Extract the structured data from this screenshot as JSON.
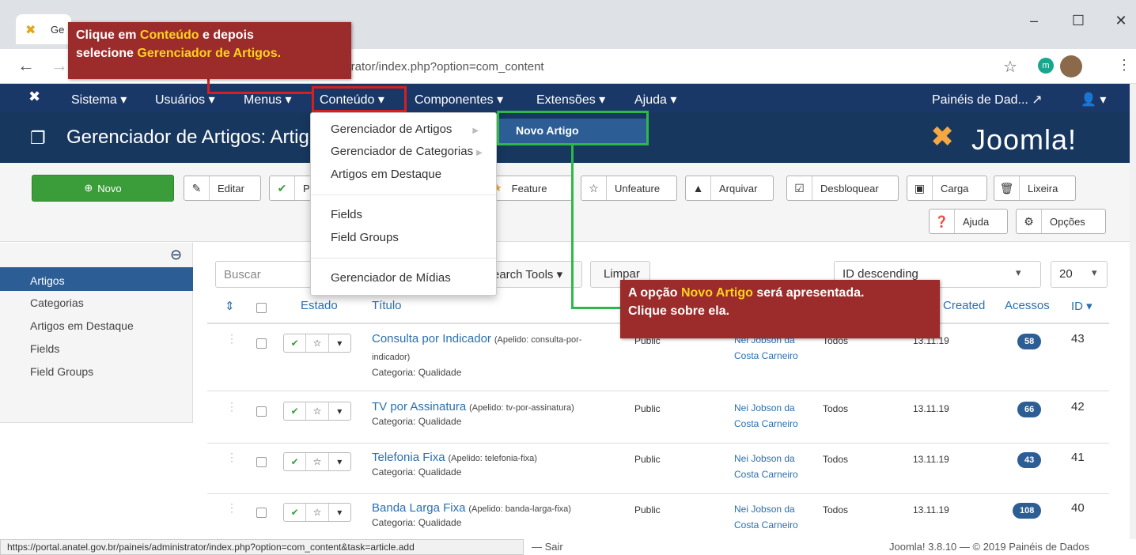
{
  "browser": {
    "tab_title": "Ge",
    "url": "strator/index.php?option=com_content",
    "ext_badge": "m",
    "min": "–",
    "max": "☐",
    "close": "✕"
  },
  "nav": {
    "items": [
      "Sistema ▾",
      "Usuários ▾",
      "Menus ▾",
      "Conteúdo ▾",
      "Componentes ▾",
      "Extensões ▾",
      "Ajuda ▾"
    ],
    "right": "Painéis de Dad... ↗",
    "user": "👤 ▾"
  },
  "header": {
    "title": "Gerenciador de Artigos: Artig",
    "logo": "Joomla!"
  },
  "toolbar": {
    "new": "Novo",
    "edit": "Editar",
    "publish": "P",
    "feature": "Feature",
    "unfeature": "Unfeature",
    "archive": "Arquivar",
    "checkin": "Desbloquear",
    "batch": "Carga",
    "trash": "Lixeira",
    "help": "Ajuda",
    "options": "Opções"
  },
  "sidebar": {
    "items": [
      "Artigos",
      "Categorias",
      "Artigos em Destaque",
      "Fields",
      "Field Groups"
    ]
  },
  "filters": {
    "search_placeholder": "Buscar",
    "search_tools": "earch Tools ▾",
    "clear": "Limpar",
    "ordering": "ID descending",
    "limit": "20"
  },
  "table": {
    "headers": {
      "status": "Estado",
      "title": "Título",
      "created": "Created",
      "hits": "Acessos",
      "id": "ID ▾"
    },
    "rows": [
      {
        "title": "Consulta por Indicador",
        "alias_a": "(Apelido: consulta-por-",
        "alias_b": "indicador)",
        "category": "Categoria: Qualidade",
        "access": "Public",
        "author1": "Nei Jobson da",
        "author2": "Costa Carneiro",
        "language": "Todos",
        "date": "13.11.19",
        "hits": "58",
        "id": "43"
      },
      {
        "title": "TV por Assinatura",
        "alias_a": "(Apelido: tv-por-assinatura)",
        "alias_b": "",
        "category": "Categoria: Qualidade",
        "access": "Public",
        "author1": "Nei Jobson da",
        "author2": "Costa Carneiro",
        "language": "Todos",
        "date": "13.11.19",
        "hits": "66",
        "id": "42"
      },
      {
        "title": "Telefonia Fixa",
        "alias_a": "(Apelido: telefonia-fixa)",
        "alias_b": "",
        "category": "Categoria: Qualidade",
        "access": "Public",
        "author1": "Nei Jobson da",
        "author2": "Costa Carneiro",
        "language": "Todos",
        "date": "13.11.19",
        "hits": "43",
        "id": "41"
      },
      {
        "title": "Banda Larga Fixa",
        "alias_a": "(Apelido: banda-larga-fixa)",
        "alias_b": "",
        "category": "Categoria: Qualidade",
        "access": "Public",
        "author1": "Nei Jobson da",
        "author2": "Costa Carneiro",
        "language": "Todos",
        "date": "13.11.19",
        "hits": "108",
        "id": "40"
      }
    ]
  },
  "content_menu": {
    "items": [
      "Gerenciador de Artigos",
      "Gerenciador de Categorias",
      "Artigos em Destaque",
      "Fields",
      "Field Groups",
      "Gerenciador de Mídias"
    ],
    "submenu_item": "Novo Artigo"
  },
  "annotations": {
    "callout1_a": "Clique em ",
    "callout1_hl1": "Conteúdo",
    "callout1_b": " e depois",
    "callout1_c": "selecione ",
    "callout1_hl2": "Gerenciador de Artigos.",
    "callout2_a": "A opção ",
    "callout2_hl": "Novo Artigo",
    "callout2_b": " será apresentada.",
    "callout2_c": "Clique sobre ela."
  },
  "status": {
    "url": "https://portal.anatel.gov.br/paineis/administrator/index.php?option=com_content&task=article.add",
    "logout": "— Sair",
    "footer": "Joomla! 3.8.10 — © 2019 Painéis de Dados"
  },
  "colors": {
    "nav_bg": "#1a3867",
    "header_bg": "#17375f",
    "accent_green": "#3a9d3a",
    "link_blue": "#2a6fb0",
    "callout_red": "#9b2c2b",
    "highlight_yellow": "#ffd21e",
    "annotation_green": "#2eb84a",
    "annotation_red": "#d61f1f"
  }
}
